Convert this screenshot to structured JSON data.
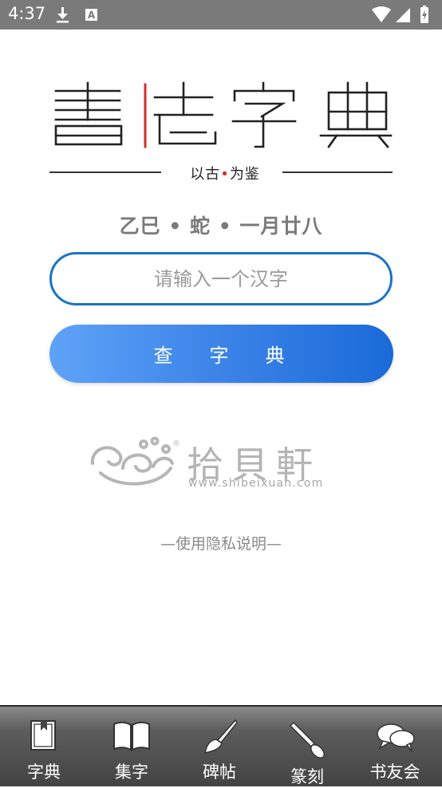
{
  "status_bar": {
    "time": "4:37",
    "left_icons": [
      "download-icon",
      "font-a-icon"
    ],
    "right_icons": [
      "wifi-icon",
      "signal-icon",
      "battery-icon"
    ],
    "background": "#7a7a7a"
  },
  "logo": {
    "title": "書法字典",
    "slogan_left": "以古",
    "slogan_dot": "•",
    "slogan_right": "为鉴",
    "accent_color": "#d62b2b"
  },
  "date_line": "乙巳 • 蛇 • 一月廿八",
  "search": {
    "placeholder": "请输入一个汉字",
    "value": "",
    "button_label": "查字典",
    "border_color": "#1a73c8",
    "button_gradient": [
      "#5fa3f7",
      "#1a6ad8"
    ]
  },
  "brand": {
    "name": "拾貝軒",
    "site": "www.shibeixuan.com",
    "mark": "®"
  },
  "privacy_link": "—使用隐私说明—",
  "tabs": [
    {
      "label": "字典",
      "icon": "bookmark-book-icon"
    },
    {
      "label": "集字",
      "icon": "open-book-icon"
    },
    {
      "label": "碑帖",
      "icon": "brush-icon"
    },
    {
      "label": "篆刻",
      "icon": "carving-knife-icon"
    },
    {
      "label": "书友会",
      "icon": "chat-bubbles-icon"
    }
  ]
}
